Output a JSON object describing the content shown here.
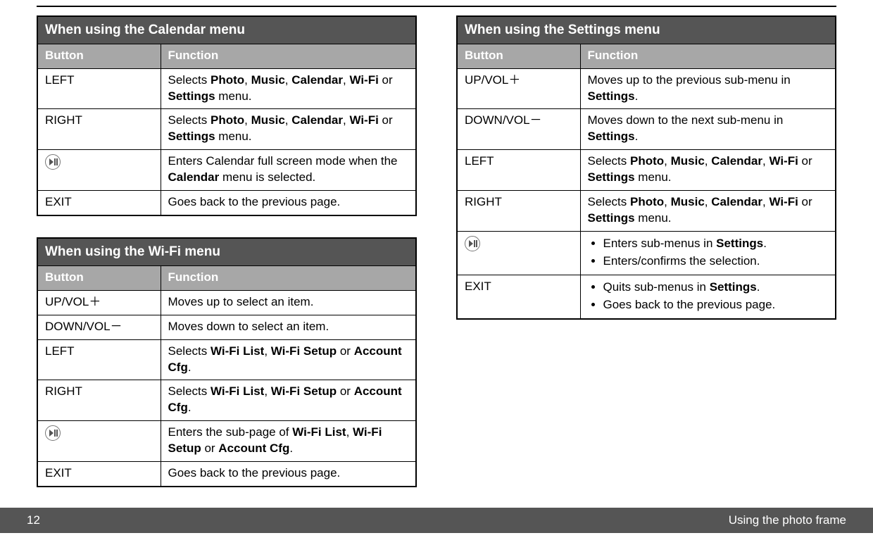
{
  "tables": {
    "calendar": {
      "title": "When using the Calendar menu",
      "head": {
        "btn": "Button",
        "fn": "Function"
      },
      "rows": [
        {
          "btn": "LEFT",
          "fn": "Selects <b>Photo</b>, <b>Music</b>, <b>Calendar</b>, <b>Wi-Fi</b> or <b>Settings</b> menu."
        },
        {
          "btn": "RIGHT",
          "fn": "Selects <b>Photo</b>, <b>Music</b>, <b>Calendar</b>, <b>Wi-Fi</b> or <b>Settings</b> menu."
        },
        {
          "btn": "@play",
          "fn": "Enters Calendar full screen mode when the <b>Calendar</b> menu is selected."
        },
        {
          "btn": "EXIT",
          "fn": "Goes back to the previous page."
        }
      ]
    },
    "wifi": {
      "title": "When using the Wi-Fi menu",
      "head": {
        "btn": "Button",
        "fn": "Function"
      },
      "rows": [
        {
          "btn": "UP/VOL＋",
          "fn": "Moves up to select an item."
        },
        {
          "btn": "DOWN/VOL－",
          "fn": "Moves down to select an item."
        },
        {
          "btn": "LEFT",
          "fn": "Selects <b>Wi-Fi List</b>, <b>Wi-Fi Setup</b> or <b>Account Cfg</b>."
        },
        {
          "btn": "RIGHT",
          "fn": "Selects <b>Wi-Fi List</b>, <b>Wi-Fi Setup</b> or <b>Account Cfg</b>."
        },
        {
          "btn": "@play",
          "fn": "Enters the sub-page of <b>Wi-Fi List</b>, <b>Wi-Fi Setup</b> or <b>Account Cfg</b>."
        },
        {
          "btn": "EXIT",
          "fn": "Goes back to the previous page."
        }
      ]
    },
    "settings": {
      "title": "When using the Settings menu",
      "head": {
        "btn": "Button",
        "fn": "Function"
      },
      "rows": [
        {
          "btn": "UP/VOL＋",
          "fn": "Moves up to the previous sub-menu in <b>Settings</b>."
        },
        {
          "btn": "DOWN/VOL－",
          "fn": "Moves down to the next sub-menu in <b>Settings</b>."
        },
        {
          "btn": "LEFT",
          "fn": "Selects <b>Photo</b>, <b>Music</b>, <b>Calendar</b>, <b>Wi-Fi</b> or <b>Settings</b> menu."
        },
        {
          "btn": "RIGHT",
          "fn": "Selects <b>Photo</b>, <b>Music</b>, <b>Calendar</b>, <b>Wi-Fi</b> or <b>Settings</b> menu."
        },
        {
          "btn": "@play",
          "fnList": [
            "Enters sub-menus in <b>Settings</b>.",
            "Enters/confirms the selection."
          ]
        },
        {
          "btn": "EXIT",
          "fnList": [
            "Quits sub-menus in <b>Settings</b>.",
            "Goes back to the previous page."
          ]
        }
      ]
    }
  },
  "footer": {
    "page": "12",
    "section": "Using the photo frame"
  }
}
